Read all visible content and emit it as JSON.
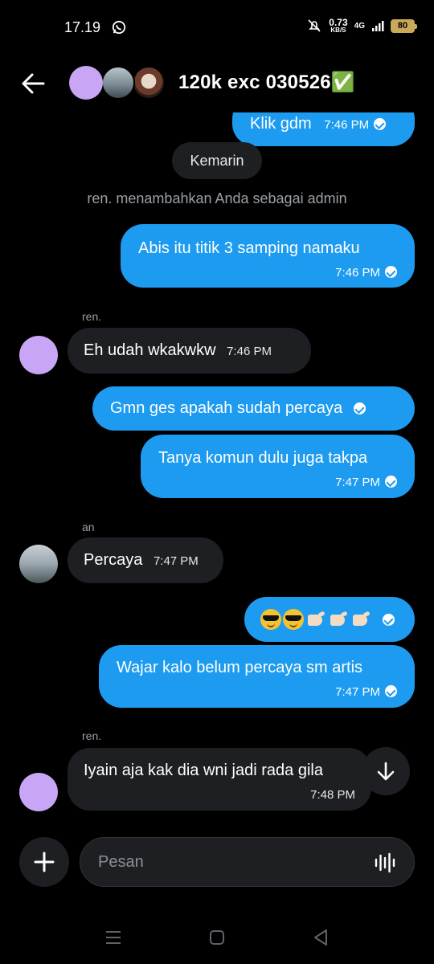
{
  "status_bar": {
    "time": "17.19",
    "speed_value": "0.73",
    "speed_unit": "KB/S",
    "network": "4G",
    "battery": "80"
  },
  "header": {
    "title": "120k exc 030526✅",
    "back_icon": "arrow-left-icon"
  },
  "messages": {
    "top_partial": {
      "text": "Klik gdm",
      "time": "7:46 PM"
    },
    "date_divider": "Kemarin",
    "system_message": "ren. menambahkan Anda sebagai admin",
    "m1": {
      "text": "Abis itu titik 3 samping namaku",
      "time": "7:46 PM"
    },
    "m2": {
      "sender": "ren.",
      "text": "Eh udah wkakwkw",
      "time": "7:46 PM"
    },
    "m3": {
      "text": "Gmn ges apakah sudah percaya"
    },
    "m4": {
      "text": "Tanya komun dulu juga takpa",
      "time": "7:47 PM"
    },
    "m5": {
      "sender": "an",
      "text": "Percaya",
      "time": "7:47 PM"
    },
    "m6": {
      "emoji": [
        "smiling-face-with-sunglasses",
        "smiling-face-with-sunglasses",
        "right-pointing-hand",
        "right-pointing-hand",
        "right-pointing-hand"
      ]
    },
    "m7": {
      "text": "Wajar kalo belum percaya sm artis",
      "time": "7:47 PM"
    },
    "m8": {
      "sender": "ren.",
      "text": "Iyain aja kak dia wni jadi rada gila",
      "time": "7:48 PM"
    }
  },
  "composer": {
    "placeholder": "Pesan"
  },
  "colors": {
    "outgoing_bubble": "#1d9bf0",
    "incoming_bubble": "#1e1f22",
    "background": "#000000"
  }
}
